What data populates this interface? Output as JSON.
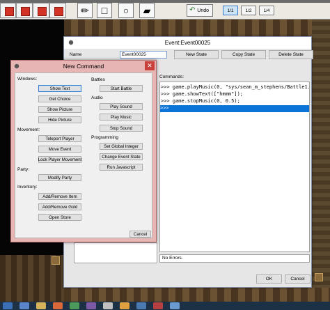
{
  "toolbar": {
    "undo_label": "Undo",
    "zoom_levels": [
      "1/1",
      "1/2",
      "1/4"
    ],
    "tools": [
      {
        "name": "pencil-icon",
        "glyph": "✏"
      },
      {
        "name": "rectangle-icon",
        "glyph": "□"
      },
      {
        "name": "circle-icon",
        "glyph": "○"
      },
      {
        "name": "fill-icon",
        "glyph": "▰"
      }
    ]
  },
  "event_window": {
    "title": "Event:Event00025",
    "name_label": "Name",
    "name_value": "Event00025",
    "new_state_label": "New State",
    "copy_state_label": "Copy State",
    "delete_state_label": "Delete State",
    "commands_label": "Commands:",
    "code_lines": [
      ">>> game.playMusic(0, \"sys/sean_m_stephens/Battle1.",
      ">>> game.showText([\"hmmm\"]);",
      ">>> game.stopMusic(0, 0.5);",
      ">>>"
    ],
    "status": "No Errors.",
    "ok_label": "OK",
    "cancel_label": "Cancel"
  },
  "new_command": {
    "title": "New Command",
    "close_glyph": "✕",
    "sections": {
      "windows": {
        "label": "Windows:",
        "buttons": [
          "Show Text",
          "Get Choice",
          "Show Picture",
          "Hide Picture"
        ]
      },
      "movement": {
        "label": "Movement:",
        "buttons": [
          "Teleport Player",
          "Move Event",
          "Lock Player Movement"
        ]
      },
      "party": {
        "label": "Party:",
        "buttons": [
          "Modify Party"
        ]
      },
      "inventory": {
        "label": "Inventory:",
        "buttons": [
          "Add/Remove Item",
          "Add/Remove Gold",
          "Open Store"
        ]
      },
      "battles": {
        "label": "Battles",
        "buttons": [
          "Start Battle"
        ]
      },
      "audio": {
        "label": "Audio",
        "buttons": [
          "Play Sound",
          "Play Music",
          "Stop Sound"
        ]
      },
      "programming": {
        "label": "Programming",
        "buttons": [
          "Set Global Integer",
          "Change Event State",
          "Run Javascript"
        ]
      }
    },
    "cancel_label": "Cancel"
  },
  "colors": {
    "dialog_frame": "#e8b5b5",
    "selection": "#0a74d8",
    "close_button": "#c7403b"
  }
}
